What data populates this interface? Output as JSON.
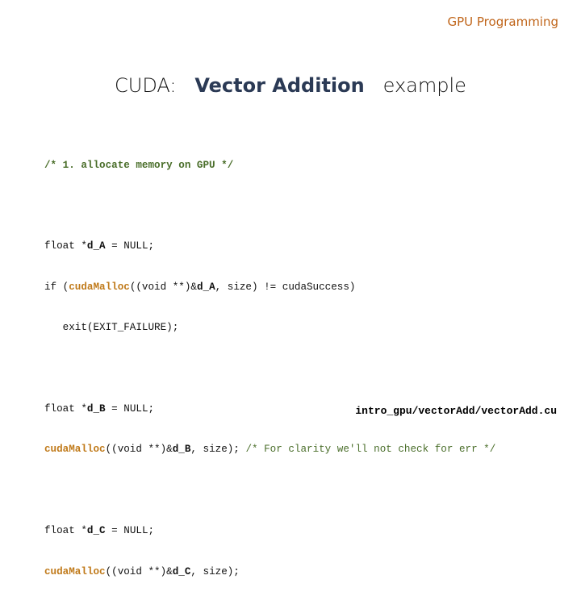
{
  "header": {
    "section": "GPU Programming"
  },
  "title": {
    "prefix": "CUDA:",
    "emphasis": "Vector Addition",
    "suffix": "example"
  },
  "code": {
    "comment1": "/* 1. allocate memory on GPU */",
    "lineA1": {
      "pre": "float *",
      "var": "d_A",
      "post": " = NULL;"
    },
    "lineA2": {
      "pre": "if (",
      "fn": "cudaMalloc",
      "mid": "((void **)&",
      "var": "d_A",
      "post": ", size) != cudaSuccess)"
    },
    "lineA3": "   exit(EXIT_FAILURE);",
    "lineB1": {
      "pre": "float *",
      "var": "d_B",
      "post": " = NULL;"
    },
    "lineB2": {
      "fn": "cudaMalloc",
      "mid": "((void **)&",
      "var": "d_B",
      "post": ", size); ",
      "comment": "/* For clarity we'll not check for err */"
    },
    "lineC1": {
      "pre": "float *",
      "var": "d_C",
      "post": " = NULL;"
    },
    "lineC2": {
      "fn": "cudaMalloc",
      "mid": "((void **)&",
      "var": "d_C",
      "post": ", size);"
    }
  },
  "footer": {
    "file_path": "intro_gpu/vectorAdd/vectorAdd.cu"
  }
}
